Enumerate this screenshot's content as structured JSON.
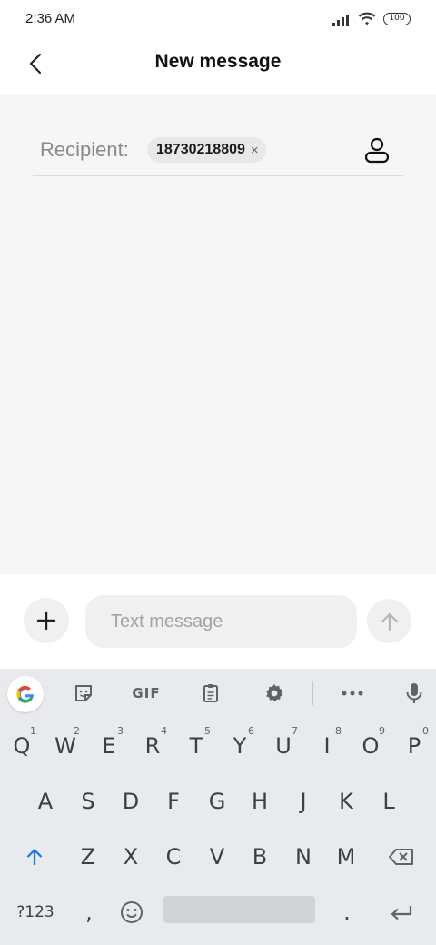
{
  "status_bar": {
    "time": "2:36 AM",
    "battery": "100",
    "icons": [
      "signal-icon",
      "wifi-icon",
      "battery-icon"
    ]
  },
  "header": {
    "title": "New message",
    "back_icon": "back-arrow-icon"
  },
  "recipient": {
    "label": "Recipient:",
    "chip_number": "18730218809",
    "chip_remove": "×",
    "contact_icon": "contact-person-icon"
  },
  "composer": {
    "placeholder": "Text message",
    "value": "",
    "attach_icon": "plus-icon",
    "send_icon": "send-arrow-icon"
  },
  "keyboard": {
    "toolbar": [
      "google-icon",
      "sticker-icon",
      "GIF",
      "clipboard-icon",
      "gear-icon",
      "more-icon",
      "mic-icon"
    ],
    "gif_label": "GIF",
    "row1": [
      {
        "k": "Q",
        "n": "1"
      },
      {
        "k": "W",
        "n": "2"
      },
      {
        "k": "E",
        "n": "3"
      },
      {
        "k": "R",
        "n": "4"
      },
      {
        "k": "T",
        "n": "5"
      },
      {
        "k": "Y",
        "n": "6"
      },
      {
        "k": "U",
        "n": "7"
      },
      {
        "k": "I",
        "n": "8"
      },
      {
        "k": "O",
        "n": "9"
      },
      {
        "k": "P",
        "n": "0"
      }
    ],
    "row2": [
      "A",
      "S",
      "D",
      "F",
      "G",
      "H",
      "J",
      "K",
      "L"
    ],
    "row3": [
      "Z",
      "X",
      "C",
      "V",
      "B",
      "N",
      "M"
    ],
    "row4": {
      "symbols": "?123",
      "comma": ",",
      "period": "."
    },
    "colors": {
      "shift_accent": "#1a73e8",
      "key_text": "#3c4043",
      "background": "#e8eaed"
    }
  }
}
